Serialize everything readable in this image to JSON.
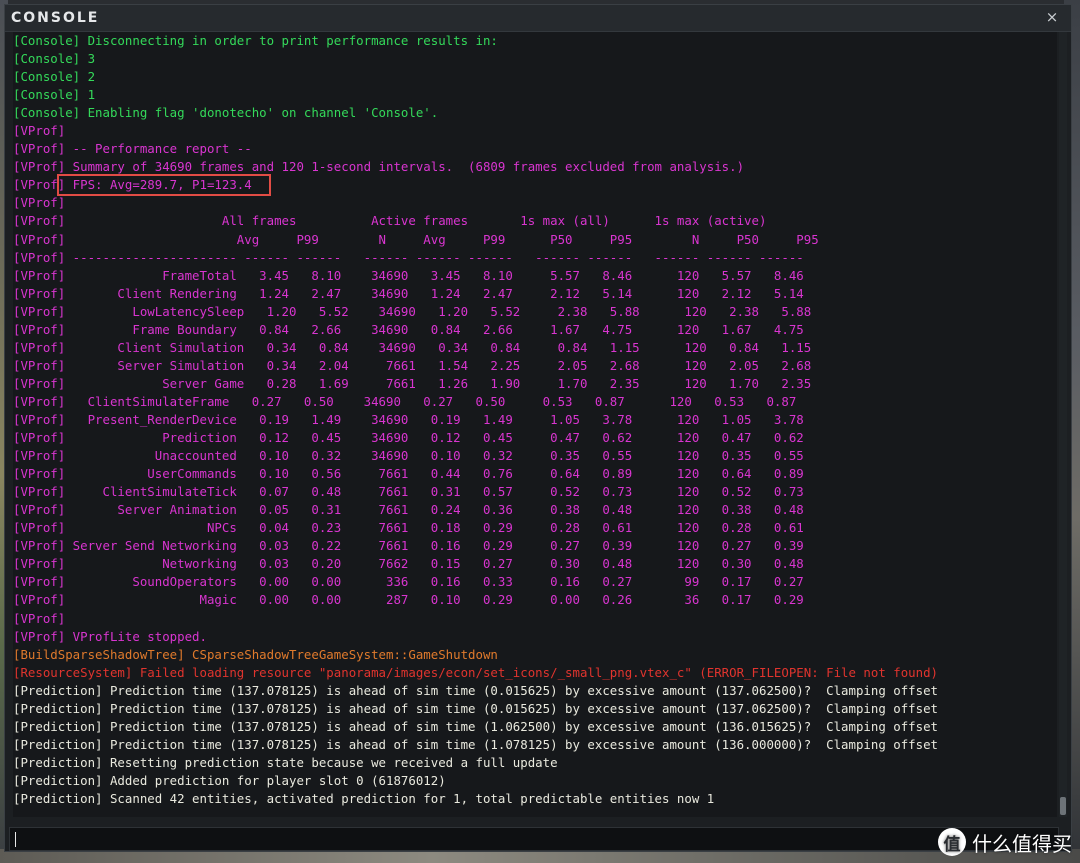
{
  "window": {
    "title": "CONSOLE",
    "close_glyph": "×"
  },
  "colors": {
    "console": "#34d95a",
    "vprof": "#d935d0",
    "orange": "#e07a2c",
    "red": "#e0342e",
    "prediction": "#e9e9de",
    "highlight_box": "#e24c45"
  },
  "log_lines": [
    {
      "type": "console",
      "text": "[Console] Disconnecting in order to print performance results in:"
    },
    {
      "type": "console",
      "text": "[Console] 3"
    },
    {
      "type": "console",
      "text": "[Console] 2"
    },
    {
      "type": "console",
      "text": "[Console] 1"
    },
    {
      "type": "console",
      "text": "[Console] Enabling flag 'donotecho' on channel 'Console'."
    },
    {
      "type": "vprof",
      "text": "[VProf]"
    },
    {
      "type": "vprof",
      "text": "[VProf] -- Performance report --"
    },
    {
      "type": "vprof",
      "text": "[VProf] Summary of 34690 frames and 120 1-second intervals.  (6809 frames excluded from analysis.)"
    },
    {
      "type": "vprof",
      "text": "[VProf] FPS: Avg=289.7, P1=123.4"
    },
    {
      "type": "vprof",
      "text": "[VProf]"
    },
    {
      "type": "vprof",
      "text": "[VProf]                     All frames          Active frames       1s max (all)      1s max (active)"
    },
    {
      "type": "vprof",
      "text": "[VProf]                       Avg     P99        N     Avg     P99      P50     P95        N     P50     P95"
    },
    {
      "type": "vprof",
      "text": "[VProf] ---------------------- ------ ------   ------ ------ ------   ------ ------   ------ ------ ------"
    },
    {
      "type": "vprof",
      "text": "[VProf]             FrameTotal   3.45   8.10    34690   3.45   8.10     5.57   8.46      120   5.57   8.46"
    },
    {
      "type": "vprof",
      "text": "[VProf]       Client Rendering   1.24   2.47    34690   1.24   2.47     2.12   5.14      120   2.12   5.14"
    },
    {
      "type": "vprof",
      "text": "[VProf]         LowLatencySleep   1.20   5.52    34690   1.20   5.52     2.38   5.88      120   2.38   5.88"
    },
    {
      "type": "vprof",
      "text": "[VProf]         Frame Boundary   0.84   2.66    34690   0.84   2.66     1.67   4.75      120   1.67   4.75"
    },
    {
      "type": "vprof",
      "text": "[VProf]       Client Simulation   0.34   0.84    34690   0.34   0.84     0.84   1.15      120   0.84   1.15"
    },
    {
      "type": "vprof",
      "text": "[VProf]       Server Simulation   0.34   2.04     7661   1.54   2.25     2.05   2.68      120   2.05   2.68"
    },
    {
      "type": "vprof",
      "text": "[VProf]             Server Game   0.28   1.69     7661   1.26   1.90     1.70   2.35      120   1.70   2.35"
    },
    {
      "type": "vprof",
      "text": "[VProf]   ClientSimulateFrame   0.27   0.50    34690   0.27   0.50     0.53   0.87      120   0.53   0.87"
    },
    {
      "type": "vprof",
      "text": "[VProf]   Present_RenderDevice   0.19   1.49    34690   0.19   1.49     1.05   3.78      120   1.05   3.78"
    },
    {
      "type": "vprof",
      "text": "[VProf]             Prediction   0.12   0.45    34690   0.12   0.45     0.47   0.62      120   0.47   0.62"
    },
    {
      "type": "vprof",
      "text": "[VProf]            Unaccounted   0.10   0.32    34690   0.10   0.32     0.35   0.55      120   0.35   0.55"
    },
    {
      "type": "vprof",
      "text": "[VProf]           UserCommands   0.10   0.56     7661   0.44   0.76     0.64   0.89      120   0.64   0.89"
    },
    {
      "type": "vprof",
      "text": "[VProf]     ClientSimulateTick   0.07   0.48     7661   0.31   0.57     0.52   0.73      120   0.52   0.73"
    },
    {
      "type": "vprof",
      "text": "[VProf]       Server Animation   0.05   0.31     7661   0.24   0.36     0.38   0.48      120   0.38   0.48"
    },
    {
      "type": "vprof",
      "text": "[VProf]                   NPCs   0.04   0.23     7661   0.18   0.29     0.28   0.61      120   0.28   0.61"
    },
    {
      "type": "vprof",
      "text": "[VProf] Server Send Networking   0.03   0.22     7661   0.16   0.29     0.27   0.39      120   0.27   0.39"
    },
    {
      "type": "vprof",
      "text": "[VProf]             Networking   0.03   0.20     7662   0.15   0.27     0.30   0.48      120   0.30   0.48"
    },
    {
      "type": "vprof",
      "text": "[VProf]         SoundOperators   0.00   0.00      336   0.16   0.33     0.16   0.27       99   0.17   0.27"
    },
    {
      "type": "vprof",
      "text": "[VProf]                  Magic   0.00   0.00      287   0.10   0.29     0.00   0.26       36   0.17   0.29"
    },
    {
      "type": "vprof",
      "text": "[VProf]"
    },
    {
      "type": "vprof",
      "text": "[VProf] VProfLite stopped."
    },
    {
      "type": "orange",
      "text": "[BuildSparseShadowTree] CSparseShadowTreeGameSystem::GameShutdown"
    },
    {
      "type": "red",
      "text": "[ResourceSystem] Failed loading resource \"panorama/images/econ/set_icons/_small_png.vtex_c\" (ERROR_FILEOPEN: File not found)"
    },
    {
      "type": "prediction",
      "text": "[Prediction] Prediction time (137.078125) is ahead of sim time (0.015625) by excessive amount (137.062500)?  Clamping offset"
    },
    {
      "type": "prediction",
      "text": "[Prediction] Prediction time (137.078125) is ahead of sim time (0.015625) by excessive amount (137.062500)?  Clamping offset"
    },
    {
      "type": "prediction",
      "text": "[Prediction] Prediction time (137.078125) is ahead of sim time (1.062500) by excessive amount (136.015625)?  Clamping offset"
    },
    {
      "type": "prediction",
      "text": "[Prediction] Prediction time (137.078125) is ahead of sim time (1.078125) by excessive amount (136.000000)?  Clamping offset"
    },
    {
      "type": "prediction",
      "text": "[Prediction] Resetting prediction state because we received a full update"
    },
    {
      "type": "prediction",
      "text": "[Prediction] Added prediction for player slot 0 (61876012)"
    },
    {
      "type": "prediction",
      "text": "[Prediction] Scanned 42 entities, activated prediction for 1, total predictable entities now 1"
    }
  ],
  "input": {
    "value": ""
  },
  "watermark": {
    "badge_glyph": "值",
    "text": "什么值得买"
  }
}
